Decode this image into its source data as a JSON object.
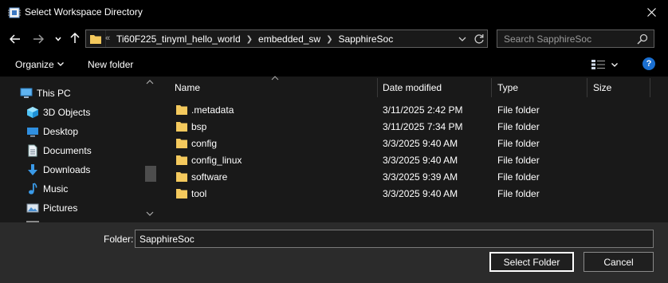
{
  "window": {
    "title": "Select Workspace Directory"
  },
  "address": {
    "overflow": "«",
    "crumbs": [
      "Ti60F225_tinyml_hello_world",
      "embedded_sw",
      "SapphireSoc"
    ]
  },
  "search": {
    "placeholder": "Search SapphireSoc"
  },
  "toolbar": {
    "organize": "Organize",
    "new_folder": "New folder"
  },
  "sidebar": {
    "items": [
      {
        "label": "This PC",
        "icon": "pc-icon"
      },
      {
        "label": "3D Objects",
        "icon": "cube-icon"
      },
      {
        "label": "Desktop",
        "icon": "desktop-icon"
      },
      {
        "label": "Documents",
        "icon": "document-icon"
      },
      {
        "label": "Downloads",
        "icon": "download-icon"
      },
      {
        "label": "Music",
        "icon": "music-icon"
      },
      {
        "label": "Pictures",
        "icon": "picture-icon"
      }
    ]
  },
  "columns": {
    "name": "Name",
    "date": "Date modified",
    "type": "Type",
    "size": "Size"
  },
  "files": [
    {
      "name": ".metadata",
      "date": "3/11/2025 2:42 PM",
      "type": "File folder"
    },
    {
      "name": "bsp",
      "date": "3/11/2025 7:34 PM",
      "type": "File folder"
    },
    {
      "name": "config",
      "date": "3/3/2025 9:40 AM",
      "type": "File folder"
    },
    {
      "name": "config_linux",
      "date": "3/3/2025 9:40 AM",
      "type": "File folder"
    },
    {
      "name": "software",
      "date": "3/3/2025 9:39 AM",
      "type": "File folder"
    },
    {
      "name": "tool",
      "date": "3/3/2025 9:40 AM",
      "type": "File folder"
    }
  ],
  "footer": {
    "folder_label": "Folder:",
    "folder_value": "SapphireSoc",
    "select_label": "Select Folder",
    "cancel_label": "Cancel"
  },
  "colors": {
    "folder": "#f4c95d",
    "accent": "#1a6fd1",
    "background": "#191919"
  }
}
